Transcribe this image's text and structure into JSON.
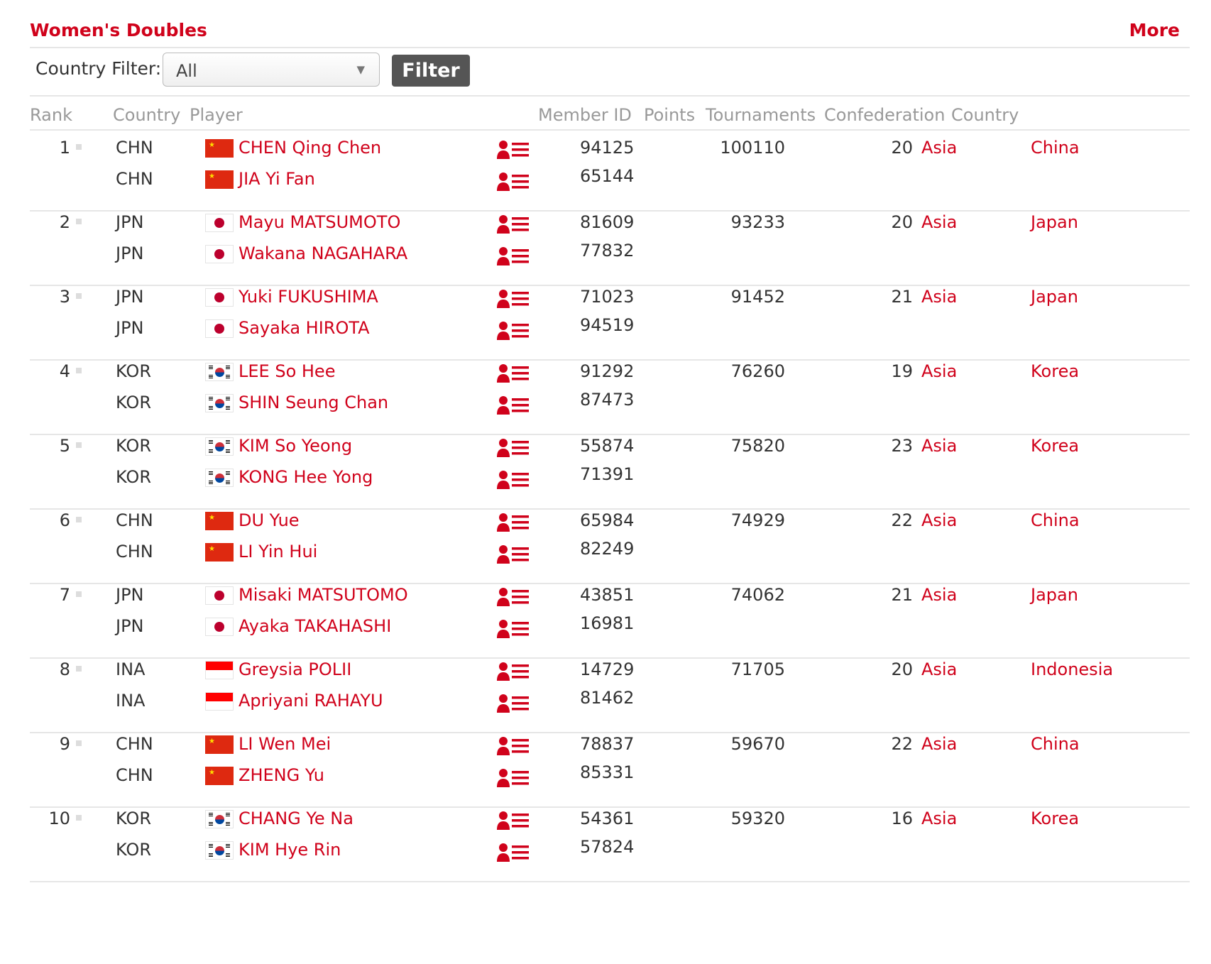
{
  "header": {
    "title": "Women's Doubles",
    "more_label": "More"
  },
  "filter": {
    "label": "Country Filter:",
    "selected": "All",
    "button_label": "Filter"
  },
  "columns": {
    "rank": "Rank",
    "country": "Country",
    "player": "Player",
    "member_id": "Member ID",
    "points": "Points",
    "tournaments": "Tournaments",
    "confederation": "Confederation",
    "country2": "Country"
  },
  "icons": {
    "flag_chn": "china-flag-icon",
    "flag_jpn": "japan-flag-icon",
    "flag_kor": "korea-flag-icon",
    "flag_ina": "indonesia-flag-icon",
    "profile": "player-profile-icon",
    "rank_marker": "rank-change-marker-icon"
  },
  "colors": {
    "accent": "#d0021b",
    "button_bg": "#555555",
    "divider": "#e6e6e6"
  },
  "rows": [
    {
      "rank": "1",
      "points": "100110",
      "tournaments": "20",
      "confederation": "Asia",
      "country": "China",
      "players": [
        {
          "code": "CHN",
          "flag": "chn",
          "name": "CHEN Qing Chen",
          "member_id": "94125"
        },
        {
          "code": "CHN",
          "flag": "chn",
          "name": "JIA Yi Fan",
          "member_id": "65144"
        }
      ]
    },
    {
      "rank": "2",
      "points": "93233",
      "tournaments": "20",
      "confederation": "Asia",
      "country": "Japan",
      "players": [
        {
          "code": "JPN",
          "flag": "jpn",
          "name": "Mayu MATSUMOTO",
          "member_id": "81609"
        },
        {
          "code": "JPN",
          "flag": "jpn",
          "name": "Wakana NAGAHARA",
          "member_id": "77832"
        }
      ]
    },
    {
      "rank": "3",
      "points": "91452",
      "tournaments": "21",
      "confederation": "Asia",
      "country": "Japan",
      "players": [
        {
          "code": "JPN",
          "flag": "jpn",
          "name": "Yuki FUKUSHIMA",
          "member_id": "71023"
        },
        {
          "code": "JPN",
          "flag": "jpn",
          "name": "Sayaka HIROTA",
          "member_id": "94519"
        }
      ]
    },
    {
      "rank": "4",
      "points": "76260",
      "tournaments": "19",
      "confederation": "Asia",
      "country": "Korea",
      "players": [
        {
          "code": "KOR",
          "flag": "kor",
          "name": "LEE So Hee",
          "member_id": "91292"
        },
        {
          "code": "KOR",
          "flag": "kor",
          "name": "SHIN Seung Chan",
          "member_id": "87473"
        }
      ]
    },
    {
      "rank": "5",
      "points": "75820",
      "tournaments": "23",
      "confederation": "Asia",
      "country": "Korea",
      "players": [
        {
          "code": "KOR",
          "flag": "kor",
          "name": "KIM So Yeong",
          "member_id": "55874"
        },
        {
          "code": "KOR",
          "flag": "kor",
          "name": "KONG Hee Yong",
          "member_id": "71391"
        }
      ]
    },
    {
      "rank": "6",
      "points": "74929",
      "tournaments": "22",
      "confederation": "Asia",
      "country": "China",
      "players": [
        {
          "code": "CHN",
          "flag": "chn",
          "name": "DU Yue",
          "member_id": "65984"
        },
        {
          "code": "CHN",
          "flag": "chn",
          "name": "LI Yin Hui",
          "member_id": "82249"
        }
      ]
    },
    {
      "rank": "7",
      "points": "74062",
      "tournaments": "21",
      "confederation": "Asia",
      "country": "Japan",
      "players": [
        {
          "code": "JPN",
          "flag": "jpn",
          "name": "Misaki MATSUTOMO",
          "member_id": "43851"
        },
        {
          "code": "JPN",
          "flag": "jpn",
          "name": "Ayaka TAKAHASHI",
          "member_id": "16981"
        }
      ]
    },
    {
      "rank": "8",
      "points": "71705",
      "tournaments": "20",
      "confederation": "Asia",
      "country": "Indonesia",
      "players": [
        {
          "code": "INA",
          "flag": "ina",
          "name": "Greysia POLII",
          "member_id": "14729"
        },
        {
          "code": "INA",
          "flag": "ina",
          "name": "Apriyani RAHAYU",
          "member_id": "81462"
        }
      ]
    },
    {
      "rank": "9",
      "points": "59670",
      "tournaments": "22",
      "confederation": "Asia",
      "country": "China",
      "players": [
        {
          "code": "CHN",
          "flag": "chn",
          "name": "LI Wen Mei",
          "member_id": "78837"
        },
        {
          "code": "CHN",
          "flag": "chn",
          "name": "ZHENG Yu",
          "member_id": "85331"
        }
      ]
    },
    {
      "rank": "10",
      "points": "59320",
      "tournaments": "16",
      "confederation": "Asia",
      "country": "Korea",
      "players": [
        {
          "code": "KOR",
          "flag": "kor",
          "name": "CHANG Ye Na",
          "member_id": "54361"
        },
        {
          "code": "KOR",
          "flag": "kor",
          "name": "KIM Hye Rin",
          "member_id": "57824"
        }
      ]
    }
  ]
}
